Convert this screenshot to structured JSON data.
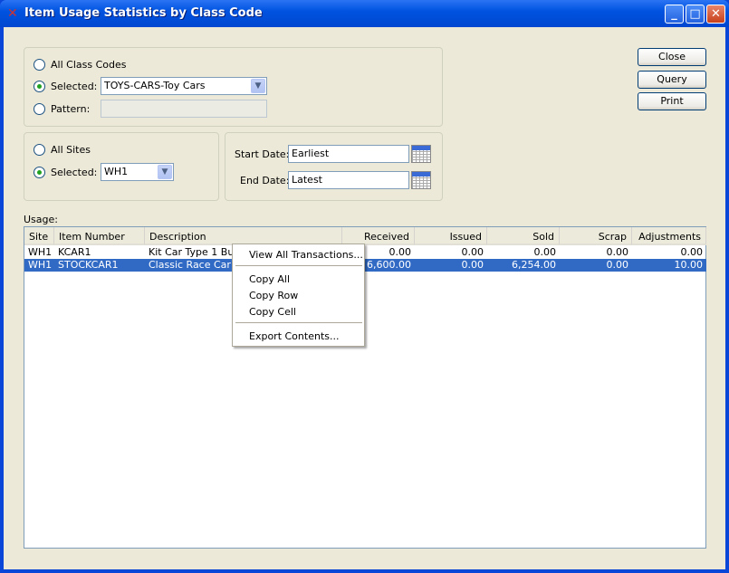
{
  "window": {
    "title": "Item Usage Statistics by Class Code",
    "icon": "app-x-icon"
  },
  "class_codes": {
    "all_label": "All Class Codes",
    "selected_label": "Selected:",
    "pattern_label": "Pattern:",
    "selected_value": "TOYS-CARS-Toy Cars",
    "pattern_value": "",
    "mode": "selected"
  },
  "sites": {
    "all_label": "All Sites",
    "selected_label": "Selected:",
    "selected_value": "WH1",
    "mode": "selected"
  },
  "dates": {
    "start_label": "Start Date:",
    "start_value": "Earliest",
    "end_label": "End Date:",
    "end_value": "Latest"
  },
  "buttons": {
    "close": "Close",
    "query": "Query",
    "print": "Print"
  },
  "usage": {
    "label": "Usage:",
    "columns": [
      "Site",
      "Item Number",
      "Description",
      "Received",
      "Issued",
      "Sold",
      "Scrap",
      "Adjustments"
    ],
    "rows": [
      [
        "WH1",
        "KCAR1",
        "Kit Car Type 1 Build",
        "0.00",
        "0.00",
        "0.00",
        "0.00",
        "0.00"
      ],
      [
        "WH1",
        "STOCKCAR1",
        "Classic Race Car W",
        "6,600.00",
        "0.00",
        "6,254.00",
        "0.00",
        "10.00"
      ]
    ],
    "selected_row": 1
  },
  "context_menu": {
    "items": [
      "View All Transactions...",
      "Copy All",
      "Copy Row",
      "Copy Cell",
      "Export Contents..."
    ]
  },
  "colors": {
    "titlebar": "#0053e0",
    "selection": "#316ac5",
    "background": "#ece9d8"
  }
}
